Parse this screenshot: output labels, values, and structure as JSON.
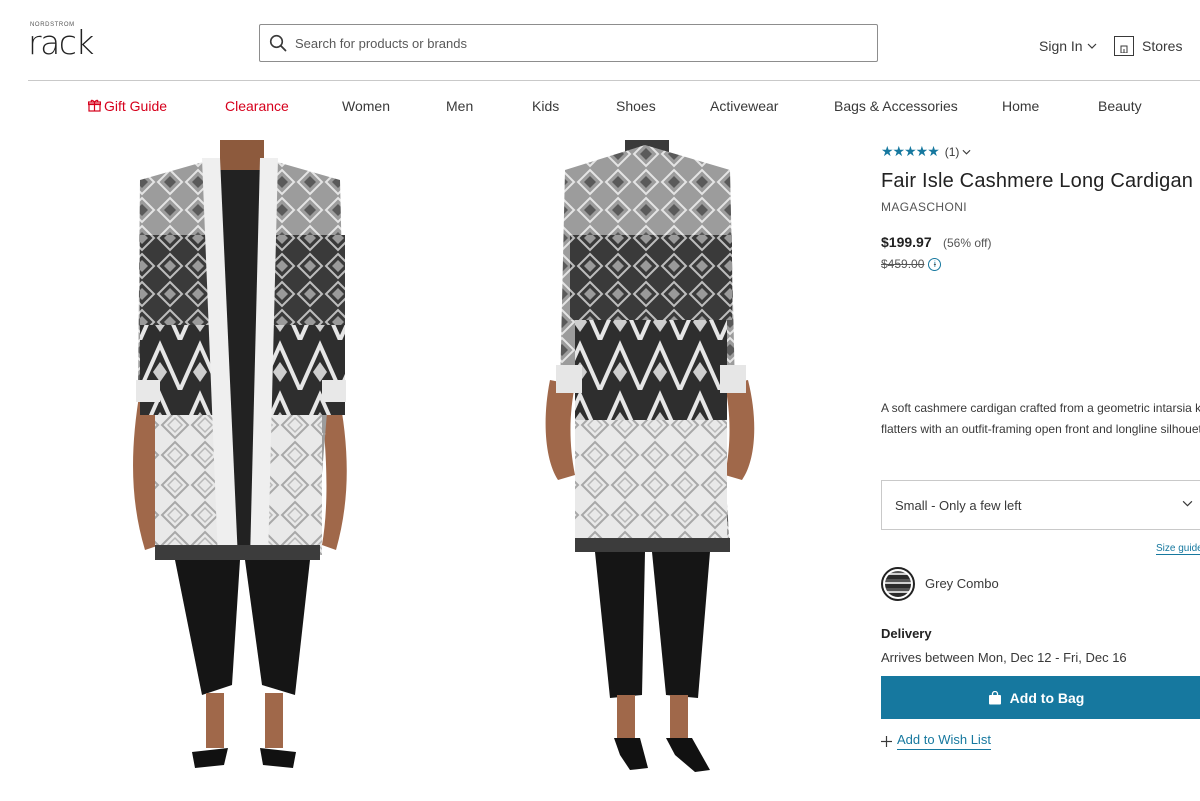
{
  "header": {
    "logo_small": "NORDSTROM",
    "logo_main": "rack",
    "search_placeholder": "Search for products or brands",
    "sign_in": "Sign In",
    "stores": "Stores"
  },
  "nav": {
    "items": [
      {
        "label": "Gift Guide",
        "color": "#d6001c"
      },
      {
        "label": "Clearance",
        "color": "#d6001c"
      },
      {
        "label": "Women"
      },
      {
        "label": "Men"
      },
      {
        "label": "Kids"
      },
      {
        "label": "Shoes"
      },
      {
        "label": "Activewear"
      },
      {
        "label": "Bags & Accessories"
      },
      {
        "label": "Home"
      },
      {
        "label": "Beauty"
      }
    ]
  },
  "product": {
    "stars": "★★★★★",
    "review_count": "(1)",
    "title": "Fair Isle Cashmere Long Cardigan",
    "brand": "MAGASCHONI",
    "price": "$199.97",
    "discount": "(56% off)",
    "original_price": "$459.00",
    "description": "A soft cashmere cardigan crafted from a geometric intarsia knit flatters with an outfit-framing open front and longline silhouette.",
    "size_selected": "Small - Only a few left",
    "size_guide": "Size guide",
    "color_name": "Grey Combo",
    "delivery_label": "Delivery",
    "delivery_text": "Arrives between Mon, Dec 12 - Fri, Dec 16",
    "add_to_bag": "Add to Bag",
    "add_to_wishlist": "Add to Wish List"
  },
  "colors": {
    "accent": "#16789f",
    "sale_red": "#d6001c",
    "text": "#393939"
  }
}
